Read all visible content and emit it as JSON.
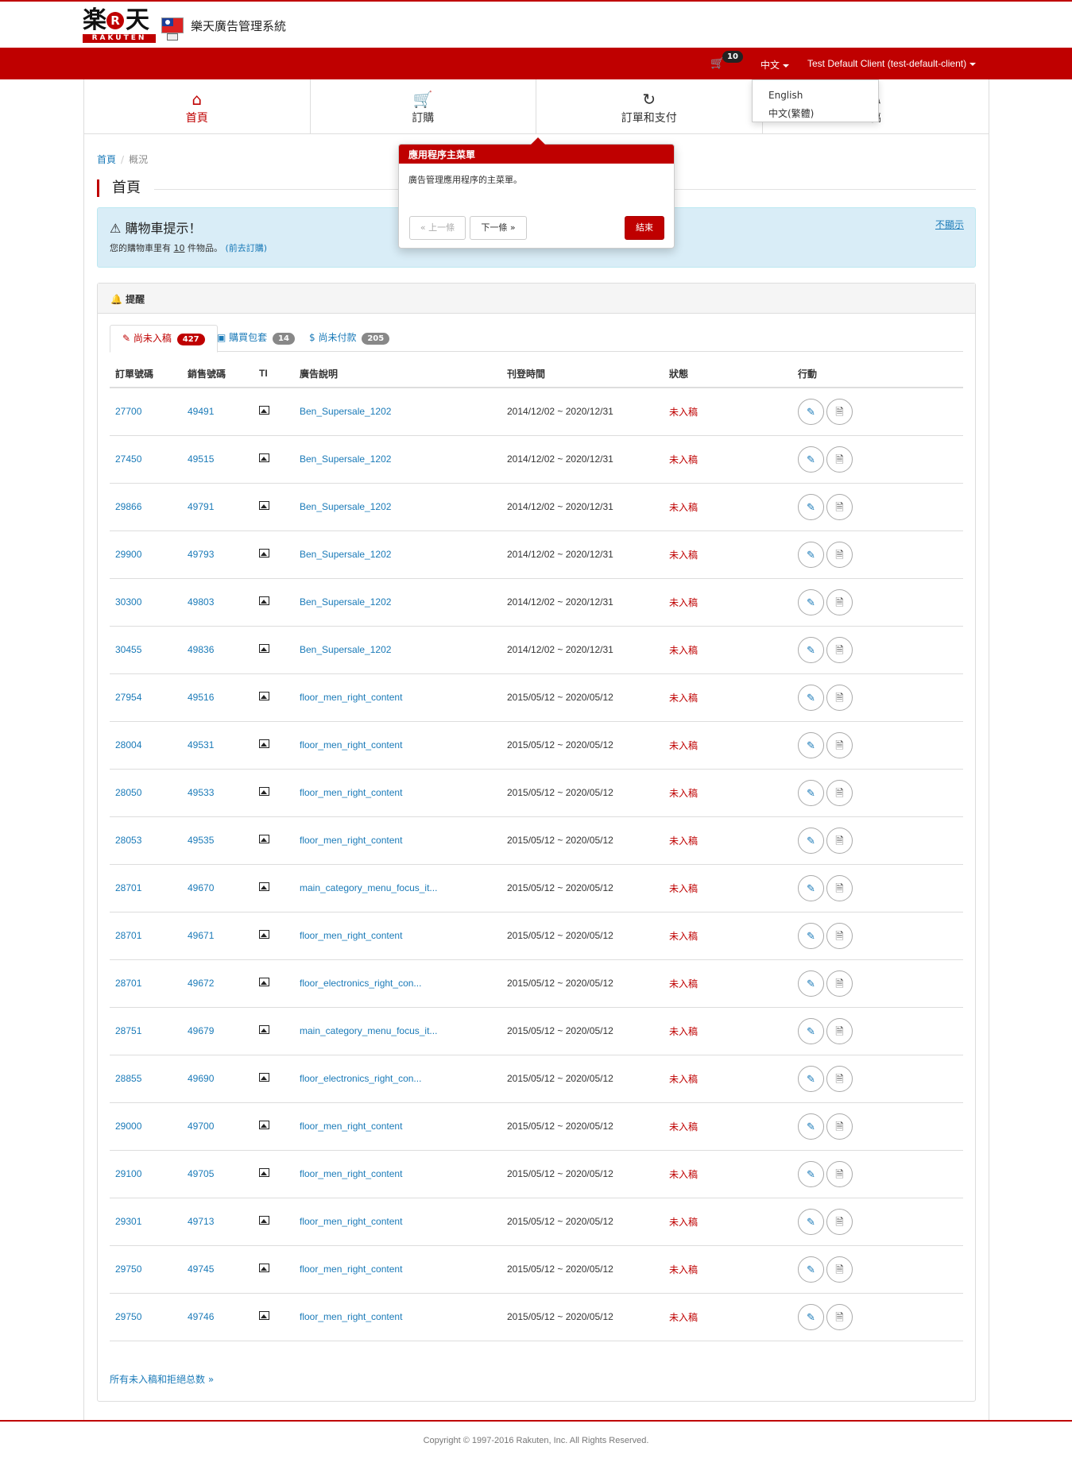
{
  "header": {
    "logo_kanji_left": "楽",
    "logo_r": "R",
    "logo_kanji_right": "天",
    "logo_wordmark": "RAKUTEN",
    "system_title": "樂天廣告管理系統",
    "cart_count": "10",
    "language": "中文",
    "client": "Test Default Client (test-default-client)"
  },
  "language_menu": [
    "English",
    "中文(繁體)"
  ],
  "nav": {
    "items": [
      {
        "label": "首頁",
        "icon": "home-icon",
        "active": true
      },
      {
        "label": "訂購",
        "icon": "cart-order-icon",
        "active": false
      },
      {
        "label": "訂單和支付",
        "icon": "history-icon",
        "active": false
      },
      {
        "label": "稿",
        "icon": "edit-icon",
        "active": false
      }
    ]
  },
  "breadcrumb": {
    "home": "首頁",
    "current": "概況"
  },
  "page_title": "首頁",
  "alert": {
    "title": "購物車提示！",
    "text_before": "您的購物車里有",
    "count": "10",
    "text_after": "件物品。",
    "link": "(前去訂購)",
    "dismiss": "不顯示"
  },
  "panel": {
    "title": "提醒",
    "tabs": [
      {
        "label": "尚未入稿",
        "count": "427"
      },
      {
        "label": "購買包套",
        "count": "14"
      },
      {
        "label": "尚未付款",
        "count": "205"
      }
    ],
    "columns": [
      "訂單號碼",
      "銷售號碼",
      "TI",
      "廣告說明",
      "刊登時間",
      "狀態",
      "行動"
    ],
    "rows": [
      [
        "27700",
        "49491",
        "Ben_Supersale_1202",
        "2014/12/02 ~ 2020/12/31",
        "未入稿"
      ],
      [
        "27450",
        "49515",
        "Ben_Supersale_1202",
        "2014/12/02 ~ 2020/12/31",
        "未入稿"
      ],
      [
        "29866",
        "49791",
        "Ben_Supersale_1202",
        "2014/12/02 ~ 2020/12/31",
        "未入稿"
      ],
      [
        "29900",
        "49793",
        "Ben_Supersale_1202",
        "2014/12/02 ~ 2020/12/31",
        "未入稿"
      ],
      [
        "30300",
        "49803",
        "Ben_Supersale_1202",
        "2014/12/02 ~ 2020/12/31",
        "未入稿"
      ],
      [
        "30455",
        "49836",
        "Ben_Supersale_1202",
        "2014/12/02 ~ 2020/12/31",
        "未入稿"
      ],
      [
        "27954",
        "49516",
        "floor_men_right_content",
        "2015/05/12 ~ 2020/05/12",
        "未入稿"
      ],
      [
        "28004",
        "49531",
        "floor_men_right_content",
        "2015/05/12 ~ 2020/05/12",
        "未入稿"
      ],
      [
        "28050",
        "49533",
        "floor_men_right_content",
        "2015/05/12 ~ 2020/05/12",
        "未入稿"
      ],
      [
        "28053",
        "49535",
        "floor_men_right_content",
        "2015/05/12 ~ 2020/05/12",
        "未入稿"
      ],
      [
        "28701",
        "49670",
        "main_category_menu_focus_it...",
        "2015/05/12 ~ 2020/05/12",
        "未入稿"
      ],
      [
        "28701",
        "49671",
        "floor_men_right_content",
        "2015/05/12 ~ 2020/05/12",
        "未入稿"
      ],
      [
        "28701",
        "49672",
        "floor_electronics_right_con...",
        "2015/05/12 ~ 2020/05/12",
        "未入稿"
      ],
      [
        "28751",
        "49679",
        "main_category_menu_focus_it...",
        "2015/05/12 ~ 2020/05/12",
        "未入稿"
      ],
      [
        "28855",
        "49690",
        "floor_electronics_right_con...",
        "2015/05/12 ~ 2020/05/12",
        "未入稿"
      ],
      [
        "29000",
        "49700",
        "floor_men_right_content",
        "2015/05/12 ~ 2020/05/12",
        "未入稿"
      ],
      [
        "29100",
        "49705",
        "floor_men_right_content",
        "2015/05/12 ~ 2020/05/12",
        "未入稿"
      ],
      [
        "29301",
        "49713",
        "floor_men_right_content",
        "2015/05/12 ~ 2020/05/12",
        "未入稿"
      ],
      [
        "29750",
        "49745",
        "floor_men_right_content",
        "2015/05/12 ~ 2020/05/12",
        "未入稿"
      ],
      [
        "29750",
        "49746",
        "floor_men_right_content",
        "2015/05/12 ~ 2020/05/12",
        "未入稿"
      ]
    ],
    "all_link": "所有未入稿和拒絕总数 »"
  },
  "tour": {
    "title": "應用程序主菜單",
    "body": "廣告管理應用程序的主菜單。",
    "prev": "« 上一條",
    "next": "下一條 »",
    "end": "結束"
  },
  "footer": {
    "copyright": "Copyright © 1997-2016 Rakuten, Inc. All Rights Reserved."
  },
  "colors": {
    "brand_red": "#bf0000",
    "link_blue": "#1a7ab8",
    "alert_bg": "#d9edf7"
  }
}
